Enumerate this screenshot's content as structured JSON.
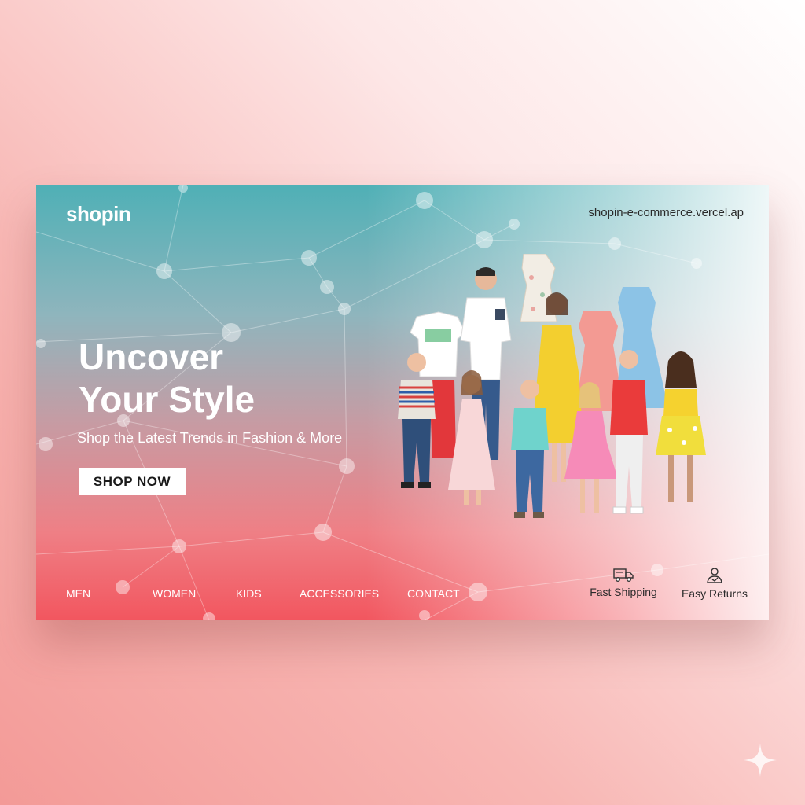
{
  "brand": {
    "logo": "shopin",
    "url": "shopin-e-commerce.vercel.ap"
  },
  "hero": {
    "headline_line1": "Uncover",
    "headline_line2": "Your Style",
    "subhead": "Shop the Latest Trends in Fashion & More",
    "cta": "SHOP NOW"
  },
  "nav": {
    "items": [
      "MEN",
      "WOMEN",
      "KIDS",
      "ACCESSORIES",
      "CONTACT"
    ]
  },
  "features": [
    {
      "label": "Fast Shipping",
      "icon": "truck-icon"
    },
    {
      "label": "Easy Returns",
      "icon": "return-person-icon"
    }
  ],
  "colors": {
    "teal": "#4fb0b6",
    "coral": "#f2565f",
    "white": "#ffffff",
    "text_dark": "#2a2a2a"
  }
}
